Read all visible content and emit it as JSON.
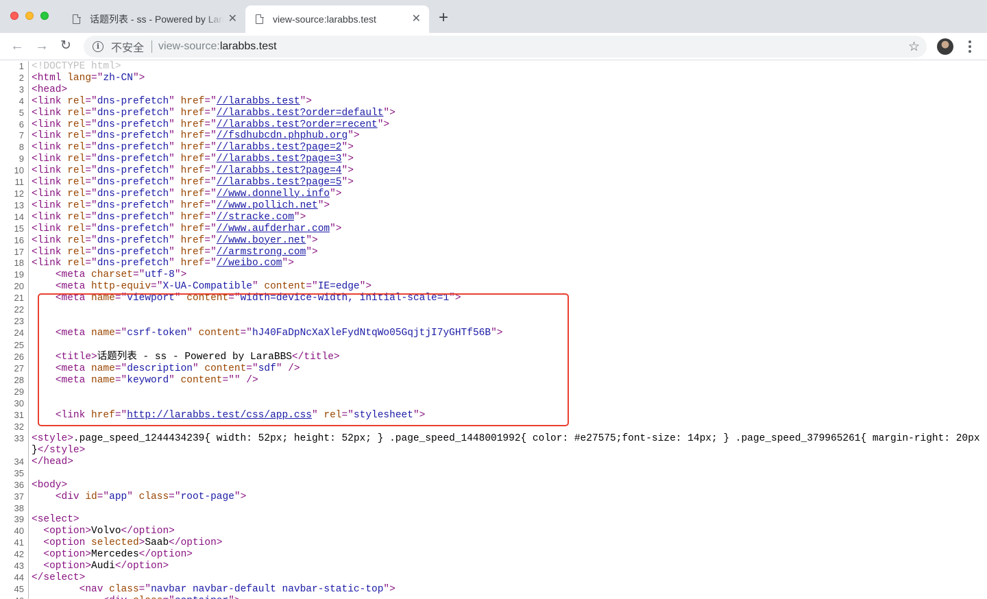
{
  "tabs": [
    {
      "title": "话题列表 - ss - Powered by LaraBBS",
      "active": false
    },
    {
      "title": "view-source:larabbs.test",
      "active": true
    }
  ],
  "toolbar": {
    "security_label": "不安全",
    "url_scheme": "view-source:",
    "url_host": "larabbs.test"
  },
  "colors": {
    "tag": "#881280",
    "attribute": "#994500",
    "value": "#1a1aa6",
    "highlight_box": "#e8402f"
  },
  "source_lines": [
    [
      [
        "d",
        "<!DOCTYPE html>"
      ]
    ],
    [
      [
        "g",
        "<html "
      ],
      [
        "a",
        "lang"
      ],
      [
        "g",
        "=\""
      ],
      [
        "v",
        "zh-CN"
      ],
      [
        "g",
        "\">"
      ]
    ],
    [
      [
        "g",
        "<head>"
      ]
    ],
    [
      [
        "g",
        "<link "
      ],
      [
        "a",
        "rel"
      ],
      [
        "g",
        "=\""
      ],
      [
        "v",
        "dns-prefetch"
      ],
      [
        "g",
        "\" "
      ],
      [
        "a",
        "href"
      ],
      [
        "g",
        "=\""
      ],
      [
        "u",
        "//larabbs.test"
      ],
      [
        "g",
        "\">"
      ]
    ],
    [
      [
        "g",
        "<link "
      ],
      [
        "a",
        "rel"
      ],
      [
        "g",
        "=\""
      ],
      [
        "v",
        "dns-prefetch"
      ],
      [
        "g",
        "\" "
      ],
      [
        "a",
        "href"
      ],
      [
        "g",
        "=\""
      ],
      [
        "u",
        "//larabbs.test?order=default"
      ],
      [
        "g",
        "\">"
      ]
    ],
    [
      [
        "g",
        "<link "
      ],
      [
        "a",
        "rel"
      ],
      [
        "g",
        "=\""
      ],
      [
        "v",
        "dns-prefetch"
      ],
      [
        "g",
        "\" "
      ],
      [
        "a",
        "href"
      ],
      [
        "g",
        "=\""
      ],
      [
        "u",
        "//larabbs.test?order=recent"
      ],
      [
        "g",
        "\">"
      ]
    ],
    [
      [
        "g",
        "<link "
      ],
      [
        "a",
        "rel"
      ],
      [
        "g",
        "=\""
      ],
      [
        "v",
        "dns-prefetch"
      ],
      [
        "g",
        "\" "
      ],
      [
        "a",
        "href"
      ],
      [
        "g",
        "=\""
      ],
      [
        "u",
        "//fsdhubcdn.phphub.org"
      ],
      [
        "g",
        "\">"
      ]
    ],
    [
      [
        "g",
        "<link "
      ],
      [
        "a",
        "rel"
      ],
      [
        "g",
        "=\""
      ],
      [
        "v",
        "dns-prefetch"
      ],
      [
        "g",
        "\" "
      ],
      [
        "a",
        "href"
      ],
      [
        "g",
        "=\""
      ],
      [
        "u",
        "//larabbs.test?page=2"
      ],
      [
        "g",
        "\">"
      ]
    ],
    [
      [
        "g",
        "<link "
      ],
      [
        "a",
        "rel"
      ],
      [
        "g",
        "=\""
      ],
      [
        "v",
        "dns-prefetch"
      ],
      [
        "g",
        "\" "
      ],
      [
        "a",
        "href"
      ],
      [
        "g",
        "=\""
      ],
      [
        "u",
        "//larabbs.test?page=3"
      ],
      [
        "g",
        "\">"
      ]
    ],
    [
      [
        "g",
        "<link "
      ],
      [
        "a",
        "rel"
      ],
      [
        "g",
        "=\""
      ],
      [
        "v",
        "dns-prefetch"
      ],
      [
        "g",
        "\" "
      ],
      [
        "a",
        "href"
      ],
      [
        "g",
        "=\""
      ],
      [
        "u",
        "//larabbs.test?page=4"
      ],
      [
        "g",
        "\">"
      ]
    ],
    [
      [
        "g",
        "<link "
      ],
      [
        "a",
        "rel"
      ],
      [
        "g",
        "=\""
      ],
      [
        "v",
        "dns-prefetch"
      ],
      [
        "g",
        "\" "
      ],
      [
        "a",
        "href"
      ],
      [
        "g",
        "=\""
      ],
      [
        "u",
        "//larabbs.test?page=5"
      ],
      [
        "g",
        "\">"
      ]
    ],
    [
      [
        "g",
        "<link "
      ],
      [
        "a",
        "rel"
      ],
      [
        "g",
        "=\""
      ],
      [
        "v",
        "dns-prefetch"
      ],
      [
        "g",
        "\" "
      ],
      [
        "a",
        "href"
      ],
      [
        "g",
        "=\""
      ],
      [
        "u",
        "//www.donnelly.info"
      ],
      [
        "g",
        "\">"
      ]
    ],
    [
      [
        "g",
        "<link "
      ],
      [
        "a",
        "rel"
      ],
      [
        "g",
        "=\""
      ],
      [
        "v",
        "dns-prefetch"
      ],
      [
        "g",
        "\" "
      ],
      [
        "a",
        "href"
      ],
      [
        "g",
        "=\""
      ],
      [
        "u",
        "//www.pollich.net"
      ],
      [
        "g",
        "\">"
      ]
    ],
    [
      [
        "g",
        "<link "
      ],
      [
        "a",
        "rel"
      ],
      [
        "g",
        "=\""
      ],
      [
        "v",
        "dns-prefetch"
      ],
      [
        "g",
        "\" "
      ],
      [
        "a",
        "href"
      ],
      [
        "g",
        "=\""
      ],
      [
        "u",
        "//stracke.com"
      ],
      [
        "g",
        "\">"
      ]
    ],
    [
      [
        "g",
        "<link "
      ],
      [
        "a",
        "rel"
      ],
      [
        "g",
        "=\""
      ],
      [
        "v",
        "dns-prefetch"
      ],
      [
        "g",
        "\" "
      ],
      [
        "a",
        "href"
      ],
      [
        "g",
        "=\""
      ],
      [
        "u",
        "//www.aufderhar.com"
      ],
      [
        "g",
        "\">"
      ]
    ],
    [
      [
        "g",
        "<link "
      ],
      [
        "a",
        "rel"
      ],
      [
        "g",
        "=\""
      ],
      [
        "v",
        "dns-prefetch"
      ],
      [
        "g",
        "\" "
      ],
      [
        "a",
        "href"
      ],
      [
        "g",
        "=\""
      ],
      [
        "u",
        "//www.boyer.net"
      ],
      [
        "g",
        "\">"
      ]
    ],
    [
      [
        "g",
        "<link "
      ],
      [
        "a",
        "rel"
      ],
      [
        "g",
        "=\""
      ],
      [
        "v",
        "dns-prefetch"
      ],
      [
        "g",
        "\" "
      ],
      [
        "a",
        "href"
      ],
      [
        "g",
        "=\""
      ],
      [
        "u",
        "//armstrong.com"
      ],
      [
        "g",
        "\">"
      ]
    ],
    [
      [
        "g",
        "<link "
      ],
      [
        "a",
        "rel"
      ],
      [
        "g",
        "=\""
      ],
      [
        "v",
        "dns-prefetch"
      ],
      [
        "g",
        "\" "
      ],
      [
        "a",
        "href"
      ],
      [
        "g",
        "=\""
      ],
      [
        "u",
        "//weibo.com"
      ],
      [
        "g",
        "\">"
      ]
    ],
    [
      [
        "t",
        "    "
      ],
      [
        "g",
        "<meta "
      ],
      [
        "a",
        "charset"
      ],
      [
        "g",
        "=\""
      ],
      [
        "v",
        "utf-8"
      ],
      [
        "g",
        "\">"
      ]
    ],
    [
      [
        "t",
        "    "
      ],
      [
        "g",
        "<meta "
      ],
      [
        "a",
        "http-equiv"
      ],
      [
        "g",
        "=\""
      ],
      [
        "v",
        "X-UA-Compatible"
      ],
      [
        "g",
        "\" "
      ],
      [
        "a",
        "content"
      ],
      [
        "g",
        "=\""
      ],
      [
        "v",
        "IE=edge"
      ],
      [
        "g",
        "\">"
      ]
    ],
    [
      [
        "t",
        "    "
      ],
      [
        "g",
        "<meta "
      ],
      [
        "a",
        "name"
      ],
      [
        "g",
        "=\""
      ],
      [
        "v",
        "viewport"
      ],
      [
        "g",
        "\" "
      ],
      [
        "a",
        "content"
      ],
      [
        "g",
        "=\""
      ],
      [
        "v",
        "width=device-width, initial-scale=1"
      ],
      [
        "g",
        "\">"
      ]
    ],
    [],
    [],
    [
      [
        "t",
        "    "
      ],
      [
        "g",
        "<meta "
      ],
      [
        "a",
        "name"
      ],
      [
        "g",
        "=\""
      ],
      [
        "v",
        "csrf-token"
      ],
      [
        "g",
        "\" "
      ],
      [
        "a",
        "content"
      ],
      [
        "g",
        "=\""
      ],
      [
        "v",
        "hJ40FaDpNcXaXleFydNtqWo05GqjtjI7yGHTf56B"
      ],
      [
        "g",
        "\">"
      ]
    ],
    [],
    [
      [
        "t",
        "    "
      ],
      [
        "g",
        "<title>"
      ],
      [
        "t",
        "话题列表 - ss - Powered by LaraBBS"
      ],
      [
        "g",
        "</title>"
      ]
    ],
    [
      [
        "t",
        "    "
      ],
      [
        "g",
        "<meta "
      ],
      [
        "a",
        "name"
      ],
      [
        "g",
        "=\""
      ],
      [
        "v",
        "description"
      ],
      [
        "g",
        "\" "
      ],
      [
        "a",
        "content"
      ],
      [
        "g",
        "=\""
      ],
      [
        "v",
        "sdf"
      ],
      [
        "g",
        "\" />"
      ]
    ],
    [
      [
        "t",
        "    "
      ],
      [
        "g",
        "<meta "
      ],
      [
        "a",
        "name"
      ],
      [
        "g",
        "=\""
      ],
      [
        "v",
        "keyword"
      ],
      [
        "g",
        "\" "
      ],
      [
        "a",
        "content"
      ],
      [
        "g",
        "=\""
      ],
      [
        "v",
        ""
      ],
      [
        "g",
        "\" />"
      ]
    ],
    [],
    [],
    [
      [
        "t",
        "    "
      ],
      [
        "g",
        "<link "
      ],
      [
        "a",
        "href"
      ],
      [
        "g",
        "=\""
      ],
      [
        "u",
        "http://larabbs.test/css/app.css"
      ],
      [
        "g",
        "\" "
      ],
      [
        "a",
        "rel"
      ],
      [
        "g",
        "=\""
      ],
      [
        "v",
        "stylesheet"
      ],
      [
        "g",
        "\">"
      ]
    ],
    [],
    [
      [
        "g",
        "<style>"
      ],
      [
        "t",
        ".page_speed_1244434239{ width: 52px; height: 52px; } .page_speed_1448001992{ color: #e27575;font-size: 14px; } .page_speed_379965261{ margin-right: 20px }"
      ],
      [
        "g",
        "</style>"
      ]
    ],
    [
      [
        "g",
        "</head>"
      ]
    ],
    [],
    [
      [
        "g",
        "<body>"
      ]
    ],
    [
      [
        "t",
        "    "
      ],
      [
        "g",
        "<div "
      ],
      [
        "a",
        "id"
      ],
      [
        "g",
        "=\""
      ],
      [
        "v",
        "app"
      ],
      [
        "g",
        "\" "
      ],
      [
        "a",
        "class"
      ],
      [
        "g",
        "=\""
      ],
      [
        "v",
        "root-page"
      ],
      [
        "g",
        "\">"
      ]
    ],
    [],
    [
      [
        "g",
        "<select>"
      ]
    ],
    [
      [
        "t",
        "  "
      ],
      [
        "g",
        "<option>"
      ],
      [
        "t",
        "Volvo"
      ],
      [
        "g",
        "</option>"
      ]
    ],
    [
      [
        "t",
        "  "
      ],
      [
        "g",
        "<option "
      ],
      [
        "a",
        "selected"
      ],
      [
        "g",
        ">"
      ],
      [
        "t",
        "Saab"
      ],
      [
        "g",
        "</option>"
      ]
    ],
    [
      [
        "t",
        "  "
      ],
      [
        "g",
        "<option>"
      ],
      [
        "t",
        "Mercedes"
      ],
      [
        "g",
        "</option>"
      ]
    ],
    [
      [
        "t",
        "  "
      ],
      [
        "g",
        "<option>"
      ],
      [
        "t",
        "Audi"
      ],
      [
        "g",
        "</option>"
      ]
    ],
    [
      [
        "g",
        "</select>"
      ]
    ],
    [
      [
        "t",
        "        "
      ],
      [
        "g",
        "<nav "
      ],
      [
        "a",
        "class"
      ],
      [
        "g",
        "=\""
      ],
      [
        "v",
        "navbar navbar-default navbar-static-top"
      ],
      [
        "g",
        "\">"
      ]
    ],
    [
      [
        "t",
        "            "
      ],
      [
        "g",
        "<div "
      ],
      [
        "a",
        "class"
      ],
      [
        "g",
        "=\""
      ],
      [
        "v",
        "container"
      ],
      [
        "g",
        "\">"
      ]
    ]
  ]
}
